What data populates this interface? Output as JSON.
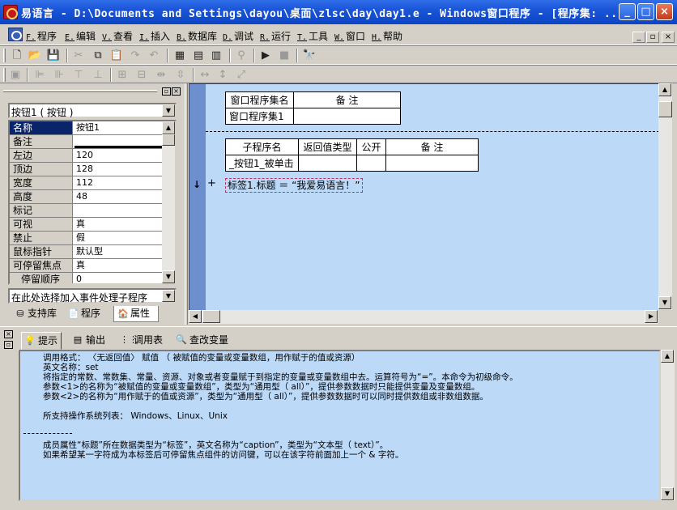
{
  "window": {
    "title": "易语言 - D:\\Documents and Settings\\dayou\\桌面\\zlsc\\day\\day1.e - Windows窗口程序 - [程序集: ...",
    "minimize": "_",
    "maximize": "□",
    "close": "×"
  },
  "menu": {
    "items": [
      {
        "key": "F.",
        "label": "程序"
      },
      {
        "key": "E.",
        "label": "编辑"
      },
      {
        "key": "V.",
        "label": "查看"
      },
      {
        "key": "I.",
        "label": "插入"
      },
      {
        "key": "B.",
        "label": "数据库"
      },
      {
        "key": "D.",
        "label": "调试"
      },
      {
        "key": "R.",
        "label": "运行"
      },
      {
        "key": "T.",
        "label": "工具"
      },
      {
        "key": "W.",
        "label": "窗口"
      },
      {
        "key": "H.",
        "label": "帮助"
      }
    ],
    "mdi_buttons": [
      "_",
      "▫",
      "×"
    ]
  },
  "toolbar": {
    "icons": [
      "new-file-icon",
      "open-folder-icon",
      "save-icon",
      "cut-icon",
      "copy-icon",
      "paste-icon",
      "redo-icon",
      "undo-icon",
      "layout1-icon",
      "layout2-icon",
      "layout3-icon",
      "pin-icon",
      "run-icon",
      "stop-icon",
      "debug-icon"
    ]
  },
  "left_panel": {
    "component": "按钮1 ( 按钮 )",
    "properties": [
      {
        "name": "名称",
        "value": "按钮1",
        "selected": true
      },
      {
        "name": "备注",
        "value": ""
      },
      {
        "name": "左边",
        "value": "120"
      },
      {
        "name": "顶边",
        "value": "128"
      },
      {
        "name": "宽度",
        "value": "112"
      },
      {
        "name": "高度",
        "value": "48"
      },
      {
        "name": "标记",
        "value": ""
      },
      {
        "name": "可视",
        "value": "真"
      },
      {
        "name": "禁止",
        "value": "假"
      },
      {
        "name": "鼠标指针",
        "value": "默认型"
      },
      {
        "name": "可停留焦点",
        "value": "真"
      },
      {
        "name": "停留顺序",
        "value": "0"
      }
    ],
    "event_select": "在此处选择加入事件处理子程序",
    "tabs": [
      {
        "label": "支持库",
        "icon": "library-icon"
      },
      {
        "label": "程序",
        "icon": "program-icon"
      },
      {
        "label": "属性",
        "icon": "property-icon"
      }
    ]
  },
  "code": {
    "assembly_table": {
      "headers": [
        "窗口程序集名",
        "备 注"
      ],
      "row": [
        "窗口程序集1",
        ""
      ]
    },
    "sub_table": {
      "headers": [
        "子程序名",
        "返回值类型",
        "公开",
        "备 注"
      ],
      "row": [
        "_按钮1_被单击",
        "",
        "",
        ""
      ]
    },
    "line_arrow": "↓",
    "line_plus": "+",
    "statement": "标签1.标题 ＝ “我爱易语言！”"
  },
  "bottom": {
    "tabs": [
      {
        "label": "提示",
        "icon": "hint-icon"
      },
      {
        "label": "输出",
        "icon": "output-icon"
      },
      {
        "label": "调用表",
        "icon": "calltable-icon"
      },
      {
        "label": "查改变量",
        "icon": "search-icon"
      }
    ],
    "hint_lines": [
      "调用格式： 〈无返回值〉 赋值 （ 被赋值的变量或变量数组，用作赋于的值或资源）",
      "英文名称：set",
      "将指定的常数、常数集、常量、资源、对象或者变量赋于到指定的变量或变量数组中去。运算符号为“=”。本命令为初级命令。",
      "参数<1>的名称为“被赋值的变量或变量数组”，类型为“通用型（ all）”，提供参数数据时只能提供变量及变量数组。",
      "参数<2>的名称为“用作赋于的值或资源”，类型为“通用型（ all）”，提供参数数据时可以同时提供数组或非数组数据。",
      "",
      "所支持操作系统列表： Windows、Linux、Unix",
      "",
      "成员属性“标题”所在数据类型为“标签”，英文名称为“caption”，类型为“文本型（ text）”。",
      "如果希望某一字符成为本标签后可停留焦点组件的访问键，可以在该字符前面加上一个 & 字符。"
    ]
  }
}
